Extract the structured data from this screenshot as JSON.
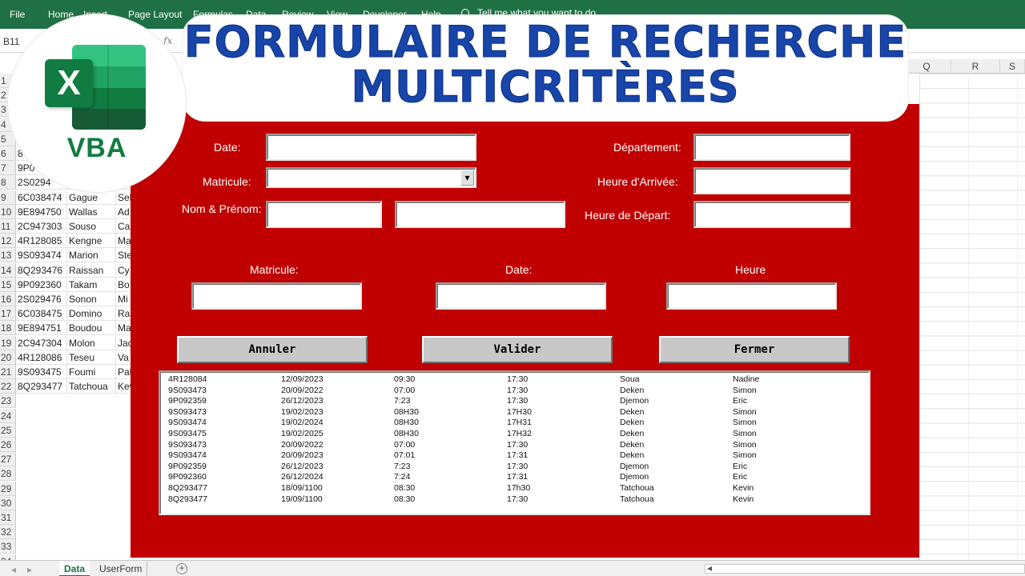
{
  "ribbon": {
    "menu": [
      "File",
      "Home",
      "Insert",
      "Page Layout",
      "Formulas",
      "Data",
      "Review",
      "View",
      "Developer",
      "Help"
    ],
    "tell_me": "Tell me what you want to do",
    "bg_color": "#1f7145"
  },
  "formula_bar": {
    "name_box": "B11",
    "fx_icon": "fx"
  },
  "sheet": {
    "column_headers_right": [
      "Q",
      "R",
      "S"
    ],
    "row_numbers": [
      "1",
      "2",
      "3",
      "4",
      "5",
      "6",
      "7",
      "8",
      "9",
      "10",
      "11",
      "12",
      "13",
      "14",
      "15",
      "16",
      "17",
      "18",
      "19",
      "20",
      "21",
      "22",
      "23",
      "24",
      "25",
      "26",
      "27",
      "28",
      "29",
      "30",
      "31",
      "32",
      "33",
      "34"
    ],
    "rows": [
      {
        "row": "6",
        "a": "8",
        "b": "",
        "c": ""
      },
      {
        "row": "7",
        "a": "9P0",
        "b": "",
        "c": ""
      },
      {
        "row": "8",
        "a": "2S0294",
        "b": "",
        "c": ""
      },
      {
        "row": "9",
        "a": "6C038474",
        "b": "Gague",
        "c": "Seb"
      },
      {
        "row": "10",
        "a": "9E894750",
        "b": "Wallas",
        "c": "Ad"
      },
      {
        "row": "11",
        "a": "2C947303",
        "b": "Souso",
        "c": "Ca"
      },
      {
        "row": "12",
        "a": "4R128085",
        "b": "Kengne",
        "c": "Ma"
      },
      {
        "row": "13",
        "a": "9S093474",
        "b": "Marion",
        "c": "Ste"
      },
      {
        "row": "14",
        "a": "8Q293476",
        "b": "Raissan",
        "c": "Cy"
      },
      {
        "row": "15",
        "a": "9P092360",
        "b": "Takam",
        "c": "Bo"
      },
      {
        "row": "16",
        "a": "2S029476",
        "b": "Sonon",
        "c": "Mi"
      },
      {
        "row": "17",
        "a": "6C038475",
        "b": "Domino",
        "c": "Ra"
      },
      {
        "row": "18",
        "a": "9E894751",
        "b": "Boudou",
        "c": "Ma"
      },
      {
        "row": "19",
        "a": "2C947304",
        "b": "Molon",
        "c": "Jac"
      },
      {
        "row": "20",
        "a": "4R128086",
        "b": "Teseu",
        "c": "Va"
      },
      {
        "row": "21",
        "a": "9S093475",
        "b": "Foumi",
        "c": "Pat"
      },
      {
        "row": "22",
        "a": "8Q293477",
        "b": "Tatchoua",
        "c": "Kev"
      }
    ]
  },
  "tabs": {
    "active": "Data",
    "inactive": "UserForm",
    "add": "+"
  },
  "logo": {
    "letter": "X",
    "label": "VBA"
  },
  "banner": {
    "line1": "FORMULAIRE DE RECHERCHE",
    "line2": "MULTICRITÈRES",
    "color": "#1745a9"
  },
  "form": {
    "bg_color": "#c00000",
    "labels": {
      "date": "Date:",
      "matricule": "Matricule:",
      "nom_prenom": "Nom & Prénom:",
      "departement": "Département:",
      "heure_arrivee": "Heure d'Arrivée:",
      "heure_depart": "Heure de Départ:",
      "search_matricule": "Matricule:",
      "search_date": "Date:",
      "search_heure": "Heure"
    },
    "buttons": {
      "annuler": "Annuler",
      "valider": "Valider",
      "fermer": "Fermer"
    },
    "list": [
      [
        "4R128084",
        "12/09/2023",
        "09:30",
        "17:30",
        "Soua",
        "Nadine"
      ],
      [
        "9S093473",
        "20/09/2022",
        "07:00",
        "17:30",
        "Deken",
        "Simon"
      ],
      [
        "9P092359",
        "26/12/2023",
        "7:23",
        "17:30",
        "Djemon",
        "Eric"
      ],
      [
        "9S093473",
        "19/02/2023",
        "08H30",
        "17H30",
        "Deken",
        "Simon"
      ],
      [
        "9S093474",
        "19/02/2024",
        "08H30",
        "17H31",
        "Deken",
        "Simon"
      ],
      [
        "9S093475",
        "19/02/2025",
        "08H30",
        "17H32",
        "Deken",
        "Simon"
      ],
      [
        "9S093473",
        "20/09/2022",
        "07:00",
        "17:30",
        "Deken",
        "Simon"
      ],
      [
        "9S093474",
        "20/09/2023",
        "07:01",
        "17:31",
        "Deken",
        "Simon"
      ],
      [
        "9P092359",
        "26/12/2023",
        "7:23",
        "17:30",
        "Djemon",
        "Eric"
      ],
      [
        "9P092360",
        "26/12/2024",
        "7:24",
        "17:31",
        "Djemon",
        "Eric"
      ],
      [
        "8Q293477",
        "18/09/1100",
        "08:30",
        "17h30",
        "Tatchoua",
        "Kevin"
      ],
      [
        "8Q293477",
        "19/09/1100",
        "08:30",
        "17:30",
        "Tatchoua",
        "Kevin"
      ]
    ]
  }
}
